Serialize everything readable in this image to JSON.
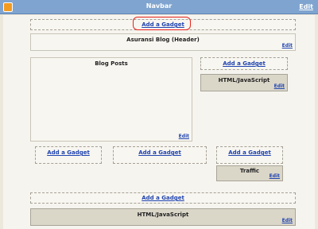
{
  "navbar": {
    "title": "Navbar",
    "edit_label": "Edit"
  },
  "header": {
    "add_gadget": "Add a Gadget",
    "title": "Asuransi Blog (Header)",
    "edit_label": "Edit"
  },
  "main": {
    "title": "Blog Posts",
    "edit_label": "Edit"
  },
  "sidebar": {
    "add_gadget": "Add a Gadget",
    "widget": {
      "title": "HTML/JavaScript",
      "edit_label": "Edit"
    }
  },
  "footer_row": {
    "slots": [
      {
        "add_gadget": "Add a Gadget"
      },
      {
        "add_gadget": "Add a Gadget"
      },
      {
        "add_gadget": "Add a Gadget"
      }
    ],
    "traffic": {
      "title": "Traffic",
      "edit_label": "Edit"
    }
  },
  "footer": {
    "add_gadget": "Add a Gadget",
    "widget": {
      "title": "HTML/JavaScript",
      "edit_label": "Edit"
    }
  },
  "colors": {
    "highlight": "#e8231c",
    "link": "#2044b0",
    "navbar": "#7fa4cf"
  }
}
